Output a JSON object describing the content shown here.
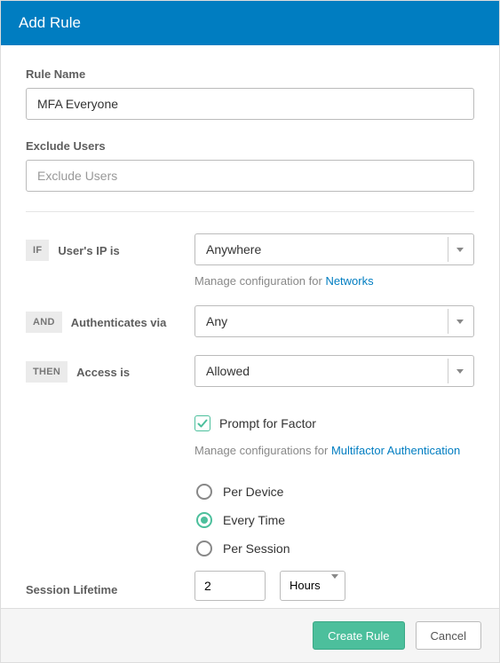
{
  "header": {
    "title": "Add Rule"
  },
  "ruleName": {
    "label": "Rule Name",
    "value": "MFA Everyone"
  },
  "excludeUsers": {
    "label": "Exclude Users",
    "placeholder": "Exclude Users",
    "value": ""
  },
  "conditions": {
    "if": {
      "tag": "IF",
      "label": "User's IP is",
      "value": "Anywhere",
      "helperPrefix": "Manage configuration for ",
      "helperLink": "Networks"
    },
    "and": {
      "tag": "AND",
      "label": "Authenticates via",
      "value": "Any"
    },
    "then": {
      "tag": "THEN",
      "label": "Access is",
      "value": "Allowed"
    }
  },
  "promptFactor": {
    "checked": true,
    "label": "Prompt for Factor",
    "helperPrefix": "Manage configurations for ",
    "helperLink": "Multifactor Authentication"
  },
  "promptFrequency": {
    "options": [
      {
        "id": "per-device",
        "label": "Per Device",
        "checked": false
      },
      {
        "id": "every-time",
        "label": "Every Time",
        "checked": true
      },
      {
        "id": "per-session",
        "label": "Per Session",
        "checked": false
      }
    ]
  },
  "sessionLifetime": {
    "label": "Session Lifetime",
    "value": "2",
    "unit": "Hours"
  },
  "footer": {
    "primary": "Create Rule",
    "secondary": "Cancel"
  }
}
